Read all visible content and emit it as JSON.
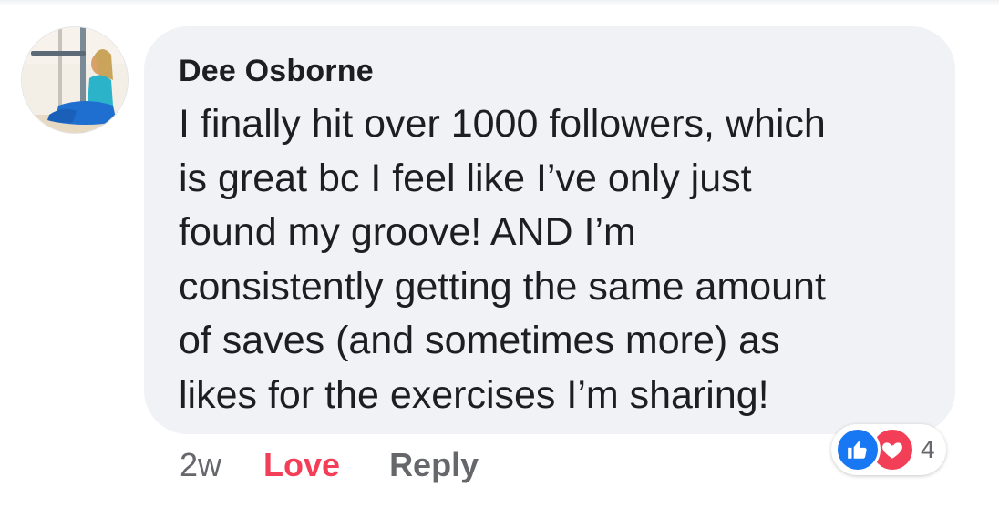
{
  "comment": {
    "author": "Dee Osborne",
    "text": "I finally hit over 1000 followers, which\nis great bc I feel like I’ve only just\nfound my groove!  AND I’m\nconsistently getting the same amount\nof saves (and sometimes more) as\nlikes for the exercises I’m sharing!",
    "avatar_icon": "profile-photo"
  },
  "actions": {
    "timestamp": "2w",
    "love_label": "Love",
    "reply_label": "Reply"
  },
  "reactions": {
    "icons": [
      "like-icon",
      "love-icon"
    ],
    "count": "4"
  },
  "colors": {
    "bubble": "#f0f2f5",
    "text": "#1c1e21",
    "secondary": "#65676b",
    "love": "#f33e58",
    "like": "#1877f2"
  }
}
